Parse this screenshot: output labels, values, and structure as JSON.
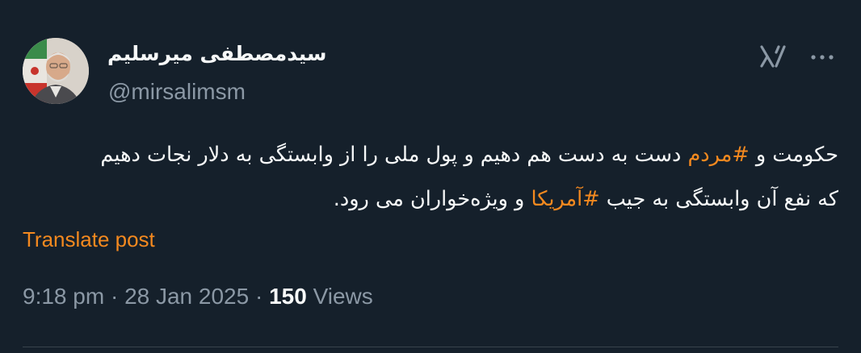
{
  "author": {
    "display_name": "سیدمصطفی میرسلیم",
    "handle": "@mirsalimsm"
  },
  "icons": {
    "grok": "grok-icon",
    "more": "more-icon"
  },
  "tweet": {
    "line1_part1": "حکومت و ",
    "hashtag1": "#مردم",
    "line1_part2": " دست به دست هم دهیم و پول ملی را از وابستگی به دلار نجات دهیم",
    "line2_part1": "که نفع آن وابستگی به جیب ",
    "hashtag2": "#آمریکا",
    "line2_part2": " و ویژه‌خواران می رود."
  },
  "translate_label": "Translate post",
  "meta": {
    "time": "9:18 pm",
    "separator1": " · ",
    "date": "28 Jan 2025",
    "separator2": " · ",
    "views_count": "150",
    "views_label": " Views"
  },
  "colors": {
    "background": "#15202b",
    "accent": "#f4891f",
    "secondary_text": "#8b98a5",
    "primary_text": "#f7f9f9"
  }
}
